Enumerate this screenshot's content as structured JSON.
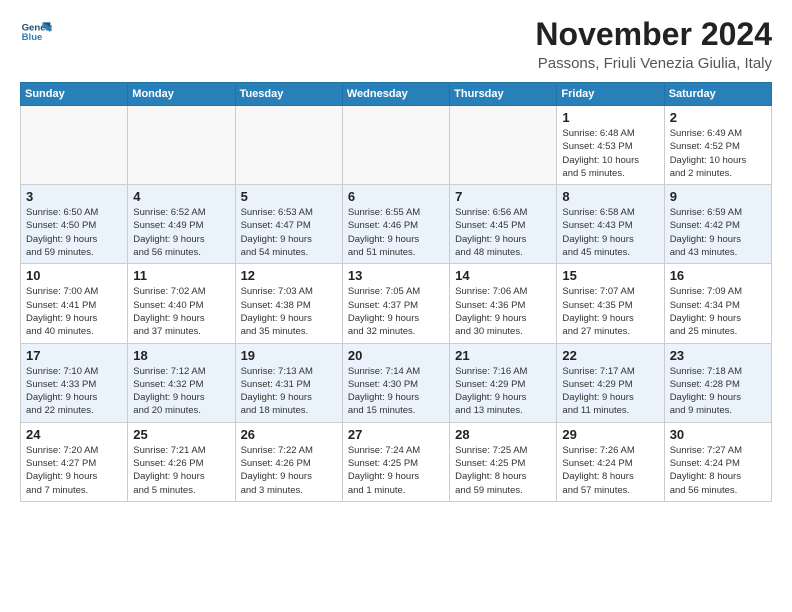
{
  "header": {
    "logo_line1": "General",
    "logo_line2": "Blue",
    "month": "November 2024",
    "location": "Passons, Friuli Venezia Giulia, Italy"
  },
  "weekdays": [
    "Sunday",
    "Monday",
    "Tuesday",
    "Wednesday",
    "Thursday",
    "Friday",
    "Saturday"
  ],
  "weeks": [
    [
      {
        "day": "",
        "info": ""
      },
      {
        "day": "",
        "info": ""
      },
      {
        "day": "",
        "info": ""
      },
      {
        "day": "",
        "info": ""
      },
      {
        "day": "",
        "info": ""
      },
      {
        "day": "1",
        "info": "Sunrise: 6:48 AM\nSunset: 4:53 PM\nDaylight: 10 hours\nand 5 minutes."
      },
      {
        "day": "2",
        "info": "Sunrise: 6:49 AM\nSunset: 4:52 PM\nDaylight: 10 hours\nand 2 minutes."
      }
    ],
    [
      {
        "day": "3",
        "info": "Sunrise: 6:50 AM\nSunset: 4:50 PM\nDaylight: 9 hours\nand 59 minutes."
      },
      {
        "day": "4",
        "info": "Sunrise: 6:52 AM\nSunset: 4:49 PM\nDaylight: 9 hours\nand 56 minutes."
      },
      {
        "day": "5",
        "info": "Sunrise: 6:53 AM\nSunset: 4:47 PM\nDaylight: 9 hours\nand 54 minutes."
      },
      {
        "day": "6",
        "info": "Sunrise: 6:55 AM\nSunset: 4:46 PM\nDaylight: 9 hours\nand 51 minutes."
      },
      {
        "day": "7",
        "info": "Sunrise: 6:56 AM\nSunset: 4:45 PM\nDaylight: 9 hours\nand 48 minutes."
      },
      {
        "day": "8",
        "info": "Sunrise: 6:58 AM\nSunset: 4:43 PM\nDaylight: 9 hours\nand 45 minutes."
      },
      {
        "day": "9",
        "info": "Sunrise: 6:59 AM\nSunset: 4:42 PM\nDaylight: 9 hours\nand 43 minutes."
      }
    ],
    [
      {
        "day": "10",
        "info": "Sunrise: 7:00 AM\nSunset: 4:41 PM\nDaylight: 9 hours\nand 40 minutes."
      },
      {
        "day": "11",
        "info": "Sunrise: 7:02 AM\nSunset: 4:40 PM\nDaylight: 9 hours\nand 37 minutes."
      },
      {
        "day": "12",
        "info": "Sunrise: 7:03 AM\nSunset: 4:38 PM\nDaylight: 9 hours\nand 35 minutes."
      },
      {
        "day": "13",
        "info": "Sunrise: 7:05 AM\nSunset: 4:37 PM\nDaylight: 9 hours\nand 32 minutes."
      },
      {
        "day": "14",
        "info": "Sunrise: 7:06 AM\nSunset: 4:36 PM\nDaylight: 9 hours\nand 30 minutes."
      },
      {
        "day": "15",
        "info": "Sunrise: 7:07 AM\nSunset: 4:35 PM\nDaylight: 9 hours\nand 27 minutes."
      },
      {
        "day": "16",
        "info": "Sunrise: 7:09 AM\nSunset: 4:34 PM\nDaylight: 9 hours\nand 25 minutes."
      }
    ],
    [
      {
        "day": "17",
        "info": "Sunrise: 7:10 AM\nSunset: 4:33 PM\nDaylight: 9 hours\nand 22 minutes."
      },
      {
        "day": "18",
        "info": "Sunrise: 7:12 AM\nSunset: 4:32 PM\nDaylight: 9 hours\nand 20 minutes."
      },
      {
        "day": "19",
        "info": "Sunrise: 7:13 AM\nSunset: 4:31 PM\nDaylight: 9 hours\nand 18 minutes."
      },
      {
        "day": "20",
        "info": "Sunrise: 7:14 AM\nSunset: 4:30 PM\nDaylight: 9 hours\nand 15 minutes."
      },
      {
        "day": "21",
        "info": "Sunrise: 7:16 AM\nSunset: 4:29 PM\nDaylight: 9 hours\nand 13 minutes."
      },
      {
        "day": "22",
        "info": "Sunrise: 7:17 AM\nSunset: 4:29 PM\nDaylight: 9 hours\nand 11 minutes."
      },
      {
        "day": "23",
        "info": "Sunrise: 7:18 AM\nSunset: 4:28 PM\nDaylight: 9 hours\nand 9 minutes."
      }
    ],
    [
      {
        "day": "24",
        "info": "Sunrise: 7:20 AM\nSunset: 4:27 PM\nDaylight: 9 hours\nand 7 minutes."
      },
      {
        "day": "25",
        "info": "Sunrise: 7:21 AM\nSunset: 4:26 PM\nDaylight: 9 hours\nand 5 minutes."
      },
      {
        "day": "26",
        "info": "Sunrise: 7:22 AM\nSunset: 4:26 PM\nDaylight: 9 hours\nand 3 minutes."
      },
      {
        "day": "27",
        "info": "Sunrise: 7:24 AM\nSunset: 4:25 PM\nDaylight: 9 hours\nand 1 minute."
      },
      {
        "day": "28",
        "info": "Sunrise: 7:25 AM\nSunset: 4:25 PM\nDaylight: 8 hours\nand 59 minutes."
      },
      {
        "day": "29",
        "info": "Sunrise: 7:26 AM\nSunset: 4:24 PM\nDaylight: 8 hours\nand 57 minutes."
      },
      {
        "day": "30",
        "info": "Sunrise: 7:27 AM\nSunset: 4:24 PM\nDaylight: 8 hours\nand 56 minutes."
      }
    ]
  ]
}
